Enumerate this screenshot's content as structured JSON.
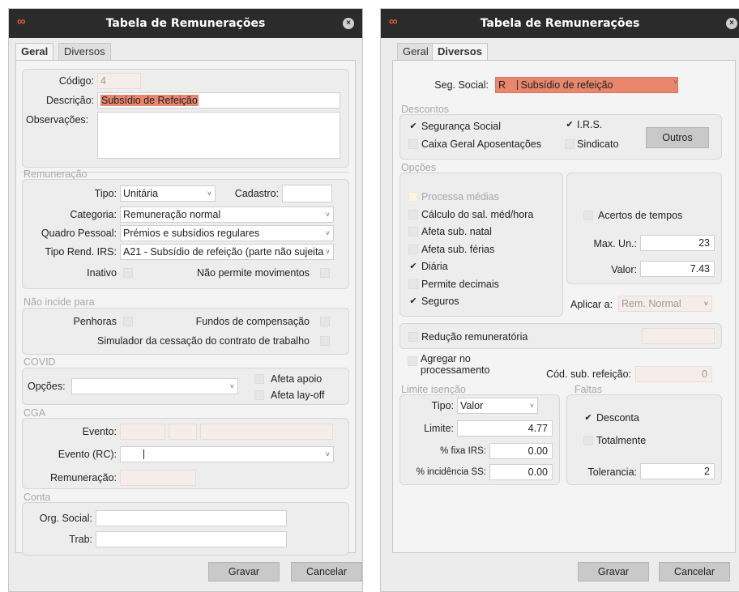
{
  "app_icon": "loop-logo-icon",
  "window_title": "Tabela de Remunerações",
  "tabs": {
    "geral": "Geral",
    "diversos": "Diversos"
  },
  "left": {
    "codigo": {
      "label": "Código:",
      "value": "4"
    },
    "descricao": {
      "label": "Descrição:",
      "value": "Subsídio de Refeição"
    },
    "observacoes": {
      "label": "Observações:",
      "value": ""
    },
    "remuneracao": {
      "title": "Remuneração",
      "tipo_label": "Tipo:",
      "tipo_value": "Unitária",
      "cadastro_label": "Cadastro:",
      "cadastro_value": "",
      "categoria_label": "Categoria:",
      "categoria_value": "Remuneração normal",
      "quadro_label": "Quadro Pessoal:",
      "quadro_value": "Prémios e subsídios regulares",
      "tipo_rend_label": "Tipo Rend. IRS:",
      "tipo_rend_value": "A21 - Subsídio de refeição (parte não sujeita",
      "inativo_label": "Inativo",
      "inativo_checked": false,
      "nao_permite_label": "Não permite movimentos",
      "nao_permite_checked": false
    },
    "nao_incide": {
      "title": "Não incide para",
      "penhoras": "Penhoras",
      "fundos": "Fundos de compensação",
      "simulador": "Simulador da cessação do contrato de trabalho"
    },
    "covid": {
      "title": "COVID",
      "opcoes_label": "Opções:",
      "opcoes_value": "",
      "afeta_apoio": "Afeta apoio",
      "afeta_layoff": "Afeta lay-off"
    },
    "cga": {
      "title": "CGA",
      "evento_label": "Evento:",
      "evento_rc_label": "Evento (RC):",
      "evento_rc_value": "",
      "remuneracao_label": "Remuneração:"
    },
    "conta": {
      "title": "Conta",
      "org_social_label": "Org. Social:",
      "org_social_value": "",
      "trab_label": "Trab:",
      "trab_value": ""
    }
  },
  "right": {
    "seg_social": {
      "label": "Seg. Social:",
      "code": "R",
      "value": "Subsídio de refeição"
    },
    "descontos": {
      "title": "Descontos",
      "seguranca_social": {
        "label": "Segurança Social",
        "checked": true
      },
      "irs": {
        "label": "I.R.S.",
        "checked": true
      },
      "cga": {
        "label": "Caixa Geral Aposentações",
        "checked": false
      },
      "sindicato": {
        "label": "Sindicato",
        "checked": false
      },
      "outros_button": "Outros"
    },
    "opcoes": {
      "title": "Opções",
      "items": [
        {
          "label": "Processa médias",
          "checked": false,
          "disabled": true
        },
        {
          "label": "Cálculo do sal. méd/hora",
          "checked": false
        },
        {
          "label": "Afeta sub. natal",
          "checked": false
        },
        {
          "label": "Afeta sub. férias",
          "checked": false
        },
        {
          "label": "Diária",
          "checked": true
        },
        {
          "label": "Permite decimais",
          "checked": false
        },
        {
          "label": "Seguros",
          "checked": true
        }
      ],
      "acertos": "Acertos de tempos",
      "max_un_label": "Max. Un.:",
      "max_un_value": "23",
      "valor_label": "Valor:",
      "valor_value": "7.43",
      "aplicar_label": "Aplicar a:",
      "aplicar_value": "Rem. Normal"
    },
    "reducao": {
      "label": "Redução remuneratória",
      "value": ""
    },
    "agregar_label": "Agregar no processamento",
    "cod_sub_label": "Cód. sub. refeição:",
    "cod_sub_value": "0",
    "limite_isencao": {
      "title": "Limite isenção",
      "tipo_label": "Tipo:",
      "tipo_value": "Valor",
      "limite_label": "Limite:",
      "limite_value": "4.77",
      "fixa_irs_label": "% fixa IRS:",
      "fixa_irs_value": "0.00",
      "incidencia_ss_label": "% incidência SS:",
      "incidencia_ss_value": "0.00"
    },
    "faltas": {
      "title": "Faltas",
      "desconta": {
        "label": "Desconta",
        "checked": true
      },
      "totalmente": {
        "label": "Totalmente",
        "checked": false
      },
      "tolerancia_label": "Tolerancia:",
      "tolerancia_value": "2"
    }
  },
  "buttons": {
    "save": "Gravar",
    "cancel": "Cancelar"
  },
  "check_mark": "✔",
  "caret_glyph": "˅"
}
